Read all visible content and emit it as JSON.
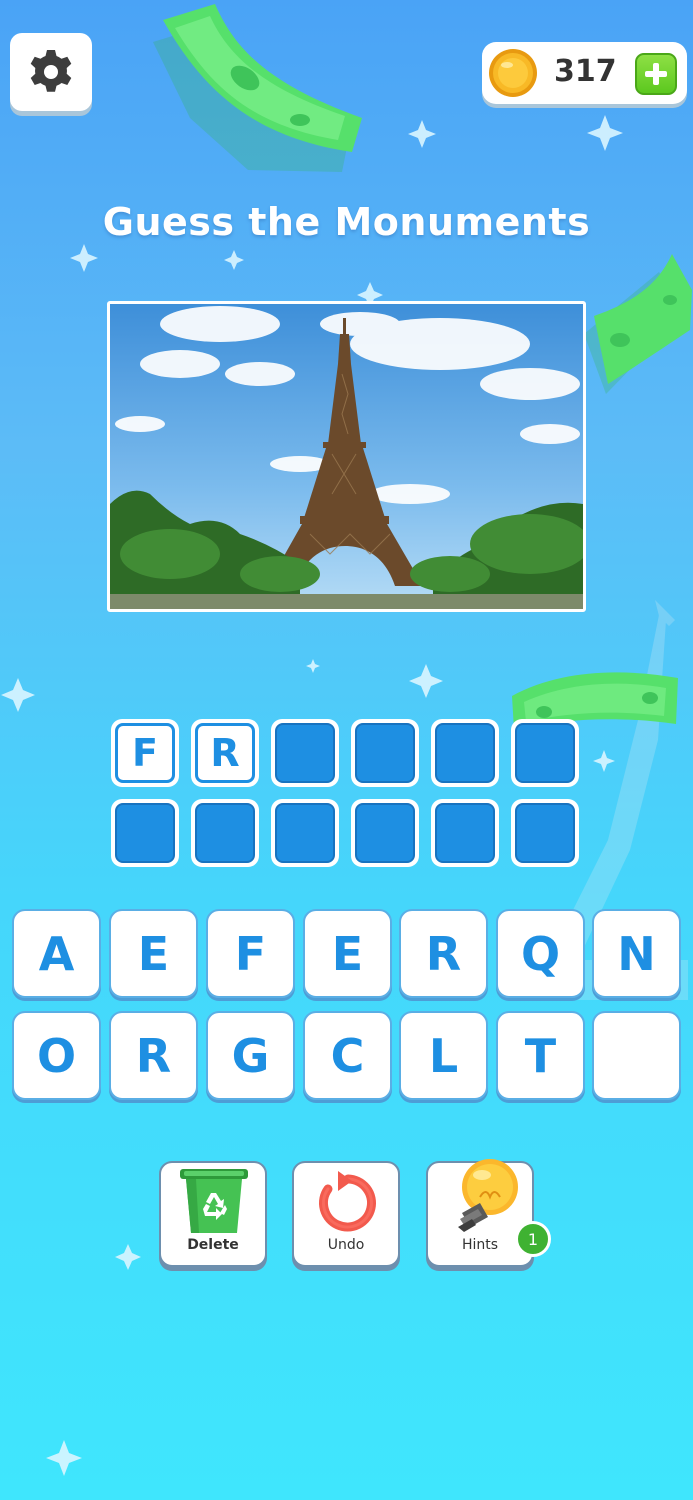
{
  "header": {
    "settings_icon": "gear-icon",
    "coins": "317",
    "coin_icon": "coin-icon",
    "add_coins_icon": "plus-icon"
  },
  "title": "Guess the Monuments",
  "puzzle": {
    "image_subject": "eiffel-tower-photo",
    "answer_slots": [
      [
        "F",
        "R",
        "",
        "",
        "",
        ""
      ],
      [
        "",
        "",
        "",
        "",
        "",
        ""
      ]
    ]
  },
  "keyboard": {
    "row1": [
      "A",
      "E",
      "F",
      "E",
      "R",
      "Q",
      "N"
    ],
    "row2": [
      "O",
      "R",
      "G",
      "C",
      "L",
      "T",
      ""
    ]
  },
  "actions": {
    "delete_label": "Delete",
    "undo_label": "Undo",
    "hints_label": "Hints",
    "hints_count": "1"
  },
  "colors": {
    "accent_blue": "#1e8fe2",
    "coin_gold": "#f6b21b",
    "money_green": "#4fe06a"
  }
}
